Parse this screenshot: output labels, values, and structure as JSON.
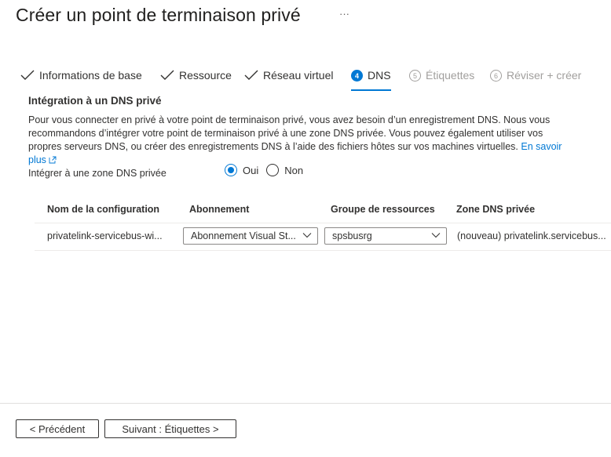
{
  "header": {
    "title": "Créer un point de terminaison privé",
    "more_label": "···"
  },
  "tabs": [
    {
      "label": "Informations de base",
      "state": "completed",
      "icon": "checkmark-icon"
    },
    {
      "label": "Ressource",
      "state": "completed",
      "icon": "checkmark-icon"
    },
    {
      "label": "Réseau virtuel",
      "state": "completed",
      "icon": "checkmark-icon"
    },
    {
      "label": "DNS",
      "state": "active",
      "step": "4"
    },
    {
      "label": "Étiquettes",
      "state": "disabled",
      "step": "5"
    },
    {
      "label": "Réviser + créer",
      "state": "disabled",
      "step": "6"
    }
  ],
  "section": {
    "title": "Intégration à un DNS privé",
    "description": "Pour vous connecter en privé à votre point de terminaison privé, vous avez besoin d’un enregistrement DNS. Nous vous recommandons d’intégrer votre point de terminaison privé à une zone DNS privée. Vous pouvez également utiliser vos propres serveurs DNS, ou créer des enregistrements DNS à l’aide des fichiers hôtes sur vos machines virtuelles.",
    "learn_more_label": "En savoir plus",
    "learn_more_icon": "external-link-icon"
  },
  "integrate": {
    "label": "Intégrer à une zone DNS privée",
    "options": [
      {
        "label": "Oui",
        "selected": true
      },
      {
        "label": "Non",
        "selected": false
      }
    ]
  },
  "table": {
    "headers": [
      "Nom de la configuration",
      "Abonnement",
      "Groupe de ressources",
      "Zone DNS privée"
    ],
    "rows": [
      {
        "config_name": "privatelink-servicebus-wi...",
        "subscription": "Abonnement Visual St...",
        "resource_group": "spsbusrg",
        "private_dns_zone": "(nouveau) privatelink.servicebus..."
      }
    ]
  },
  "footer": {
    "previous_label": "< Précédent",
    "next_label": "Suivant : Étiquettes  >"
  },
  "colors": {
    "accent": "#0078d4",
    "text": "#323130",
    "disabled": "#a19f9d"
  }
}
